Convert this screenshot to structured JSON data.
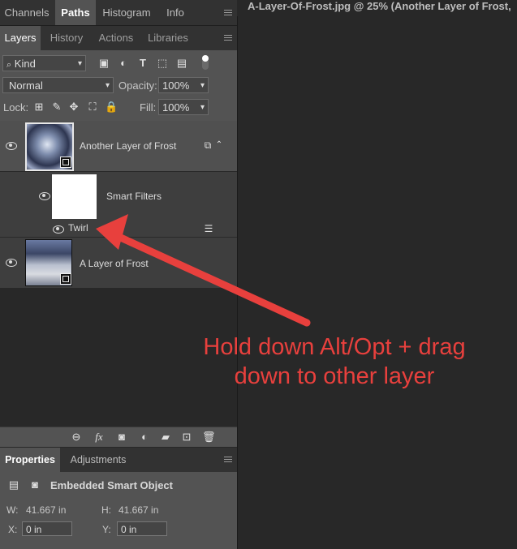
{
  "top_tabs": [
    "Channels",
    "Paths",
    "Histogram",
    "Info"
  ],
  "document_title": "A-Layer-Of-Frost.jpg @ 25% (Another Layer of Frost, ",
  "layers_tabs": [
    "Layers",
    "History",
    "Actions",
    "Libraries"
  ],
  "filter": {
    "kind": "Kind"
  },
  "blend": {
    "mode": "Normal",
    "opacity_label": "Opacity:",
    "opacity_value": "100%"
  },
  "lock": {
    "label": "Lock:",
    "fill_label": "Fill:",
    "fill_value": "100%"
  },
  "layers": [
    {
      "name": "Another Layer of Frost"
    },
    {
      "name": "Smart Filters"
    },
    {
      "name": "Twirl"
    },
    {
      "name": "A Layer of Frost"
    }
  ],
  "bottom_icons": [
    "link-icon",
    "fx-icon",
    "mask-icon",
    "adjustment-icon",
    "group-folder-icon",
    "new-layer-icon",
    "trash-icon"
  ],
  "fx_label": "fx",
  "properties": {
    "tabs": [
      "Properties",
      "Adjustments"
    ],
    "type": "Embedded Smart Object",
    "w_label": "W:",
    "w_value": "41.667 in",
    "h_label": "H:",
    "h_value": "41.667 in",
    "x_label": "X:",
    "x_value": "0 in",
    "y_label": "Y:",
    "y_value": "0 in"
  },
  "annotation": {
    "line1": "Hold down Alt/Opt + drag",
    "line2": "down to other layer"
  },
  "colors": {
    "annotation": "#e8403d",
    "panel": "#535353",
    "dark": "#282828"
  }
}
